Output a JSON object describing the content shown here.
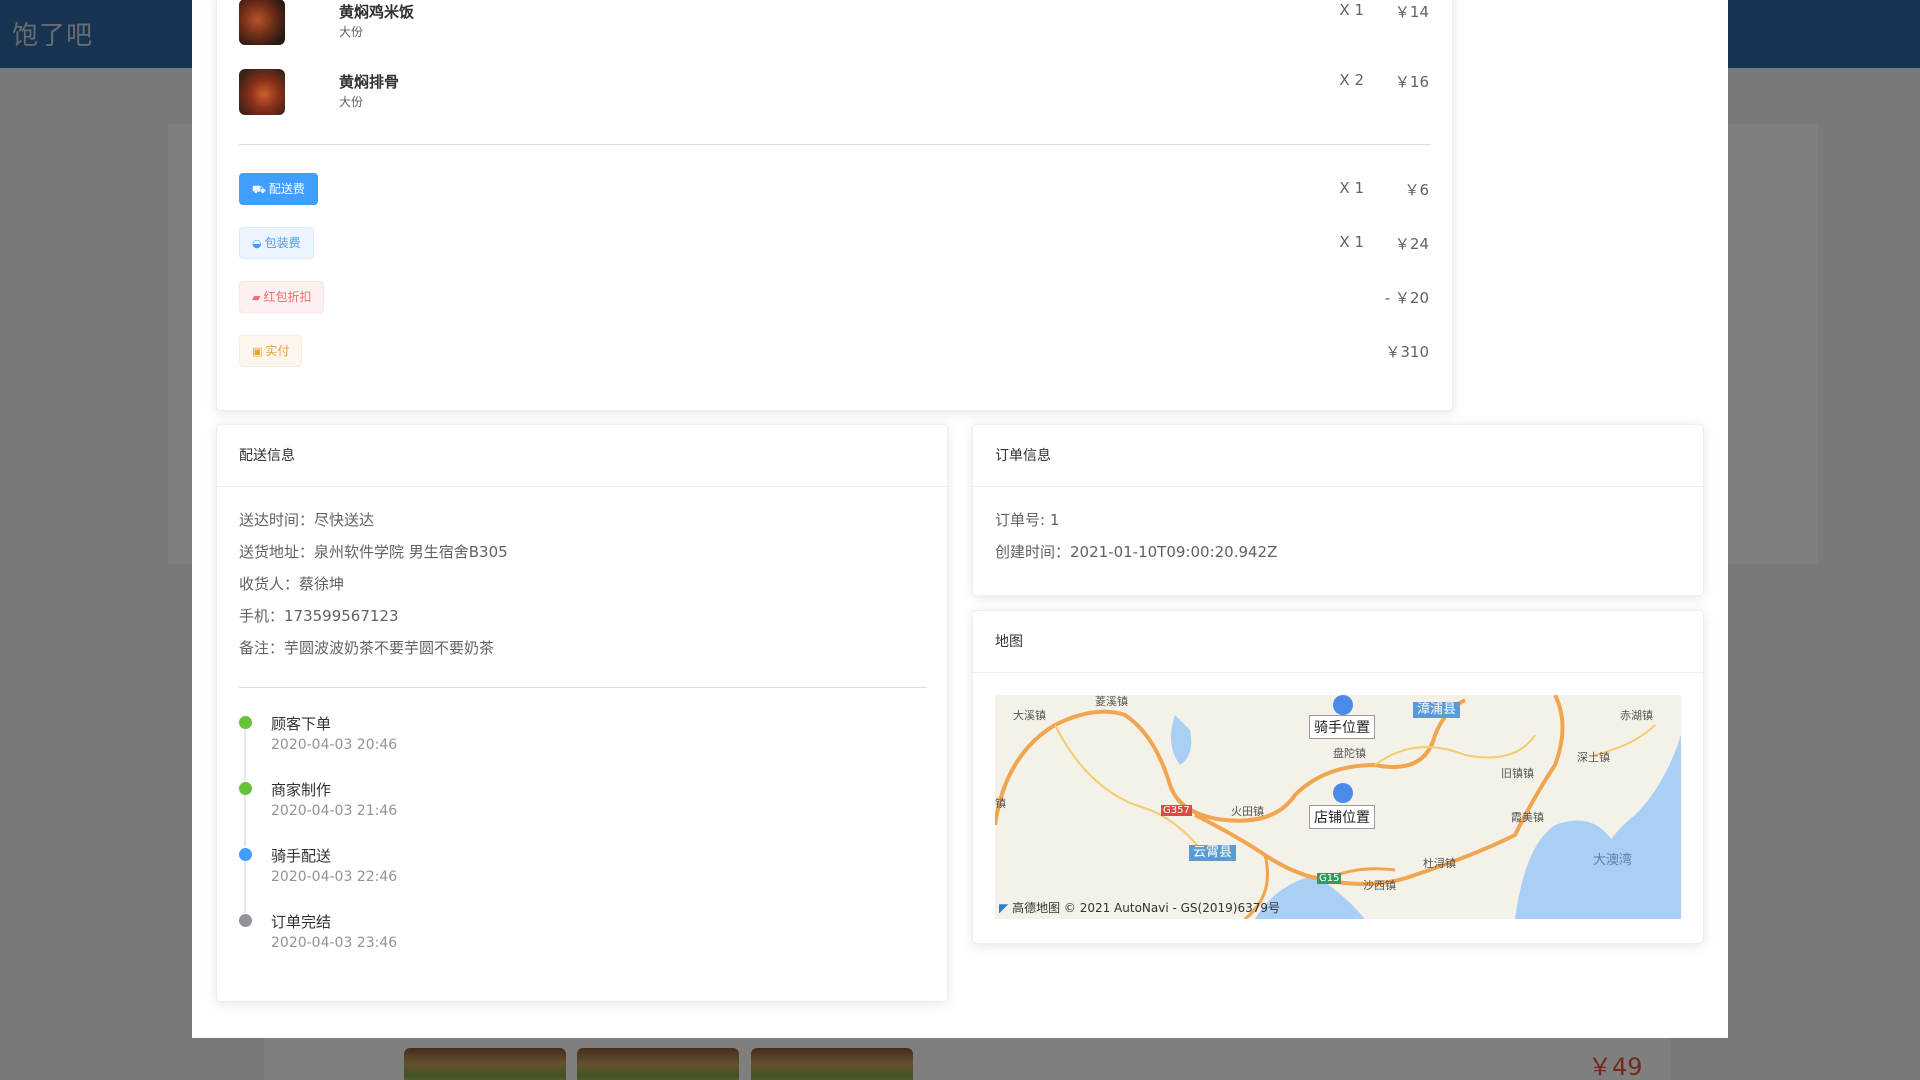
{
  "app": {
    "logo": "饱了吧"
  },
  "background": {
    "price": "￥49"
  },
  "items": [
    {
      "name": "黄焖鸡米饭",
      "spec": "大份",
      "qty": "X 1",
      "price": "￥14"
    },
    {
      "name": "黄焖排骨",
      "spec": "大份",
      "qty": "X 2",
      "price": "￥16"
    }
  ],
  "fees": {
    "delivery": {
      "label": "配送费",
      "qty": "X 1",
      "price": "￥6"
    },
    "package": {
      "label": "包装费",
      "qty": "X 1",
      "price": "￥24"
    },
    "redpack": {
      "label": "红包折扣",
      "price": "- ￥20"
    },
    "paid": {
      "label": "实付",
      "price": "￥310"
    }
  },
  "delivery": {
    "title": "配送信息",
    "time": "送达时间：尽快送达",
    "address": "送货地址：泉州软件学院 男生宿舍B305",
    "receiver": "收货人：蔡徐坤",
    "phone": "手机：173599567123",
    "note": "备注：芋圆波波奶茶不要芋圆不要奶茶",
    "timeline": [
      {
        "title": "顾客下单",
        "time": "2020-04-03 20:46",
        "color": "#67c23a"
      },
      {
        "title": "商家制作",
        "time": "2020-04-03 21:46",
        "color": "#67c23a"
      },
      {
        "title": "骑手配送",
        "time": "2020-04-03 22:46",
        "color": "#409eff"
      },
      {
        "title": "订单完结",
        "time": "2020-04-03 23:46",
        "color": "#909399"
      }
    ]
  },
  "order": {
    "title": "订单信息",
    "number": "订单号: 1",
    "created": "创建时间：2021-01-10T09:00:20.942Z"
  },
  "map": {
    "title": "地图",
    "rider_label": "骑手位置",
    "shop_label": "店铺位置",
    "copyright": "高德地图 © 2021 AutoNavi - GS(2019)6379号",
    "places": {
      "daxi": "大溪镇",
      "lingyu": "菱溪镇",
      "zhangpu": "漳浦县",
      "chihu": "赤湖镇",
      "shentu": "深土镇",
      "panto": "盘陀镇",
      "jiuzhen": "旧镇镇",
      "yuntian": "火田镇",
      "yunxiao": "云霄县",
      "xiabo": "霞美镇",
      "dushun": "杜浔镇",
      "shaxi": "沙西镇",
      "daao": "大澳湾",
      "road_g357": "G357",
      "road_g15": "G15",
      "left_edge": "镇"
    }
  }
}
